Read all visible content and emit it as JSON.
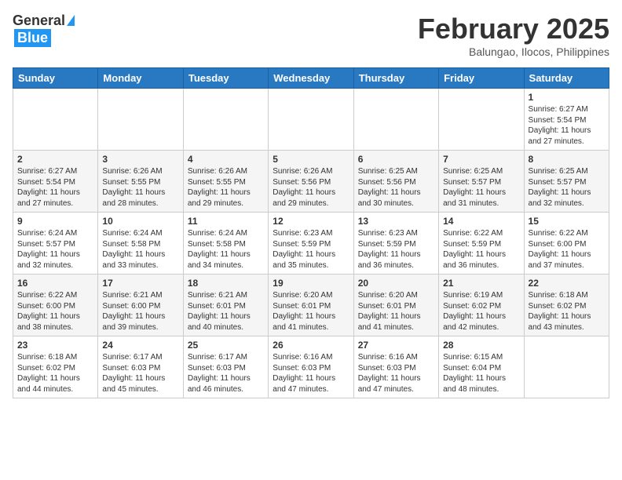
{
  "header": {
    "logo_general": "General",
    "logo_blue": "Blue",
    "month_year": "February 2025",
    "location": "Balungao, Ilocos, Philippines"
  },
  "days_of_week": [
    "Sunday",
    "Monday",
    "Tuesday",
    "Wednesday",
    "Thursday",
    "Friday",
    "Saturday"
  ],
  "weeks": [
    [
      {
        "day": "",
        "info": ""
      },
      {
        "day": "",
        "info": ""
      },
      {
        "day": "",
        "info": ""
      },
      {
        "day": "",
        "info": ""
      },
      {
        "day": "",
        "info": ""
      },
      {
        "day": "",
        "info": ""
      },
      {
        "day": "1",
        "info": "Sunrise: 6:27 AM\nSunset: 5:54 PM\nDaylight: 11 hours and 27 minutes."
      }
    ],
    [
      {
        "day": "2",
        "info": "Sunrise: 6:27 AM\nSunset: 5:54 PM\nDaylight: 11 hours and 27 minutes."
      },
      {
        "day": "3",
        "info": "Sunrise: 6:26 AM\nSunset: 5:55 PM\nDaylight: 11 hours and 28 minutes."
      },
      {
        "day": "4",
        "info": "Sunrise: 6:26 AM\nSunset: 5:55 PM\nDaylight: 11 hours and 29 minutes."
      },
      {
        "day": "5",
        "info": "Sunrise: 6:26 AM\nSunset: 5:56 PM\nDaylight: 11 hours and 29 minutes."
      },
      {
        "day": "6",
        "info": "Sunrise: 6:25 AM\nSunset: 5:56 PM\nDaylight: 11 hours and 30 minutes."
      },
      {
        "day": "7",
        "info": "Sunrise: 6:25 AM\nSunset: 5:57 PM\nDaylight: 11 hours and 31 minutes."
      },
      {
        "day": "8",
        "info": "Sunrise: 6:25 AM\nSunset: 5:57 PM\nDaylight: 11 hours and 32 minutes."
      }
    ],
    [
      {
        "day": "9",
        "info": "Sunrise: 6:24 AM\nSunset: 5:57 PM\nDaylight: 11 hours and 32 minutes."
      },
      {
        "day": "10",
        "info": "Sunrise: 6:24 AM\nSunset: 5:58 PM\nDaylight: 11 hours and 33 minutes."
      },
      {
        "day": "11",
        "info": "Sunrise: 6:24 AM\nSunset: 5:58 PM\nDaylight: 11 hours and 34 minutes."
      },
      {
        "day": "12",
        "info": "Sunrise: 6:23 AM\nSunset: 5:59 PM\nDaylight: 11 hours and 35 minutes."
      },
      {
        "day": "13",
        "info": "Sunrise: 6:23 AM\nSunset: 5:59 PM\nDaylight: 11 hours and 36 minutes."
      },
      {
        "day": "14",
        "info": "Sunrise: 6:22 AM\nSunset: 5:59 PM\nDaylight: 11 hours and 36 minutes."
      },
      {
        "day": "15",
        "info": "Sunrise: 6:22 AM\nSunset: 6:00 PM\nDaylight: 11 hours and 37 minutes."
      }
    ],
    [
      {
        "day": "16",
        "info": "Sunrise: 6:22 AM\nSunset: 6:00 PM\nDaylight: 11 hours and 38 minutes."
      },
      {
        "day": "17",
        "info": "Sunrise: 6:21 AM\nSunset: 6:00 PM\nDaylight: 11 hours and 39 minutes."
      },
      {
        "day": "18",
        "info": "Sunrise: 6:21 AM\nSunset: 6:01 PM\nDaylight: 11 hours and 40 minutes."
      },
      {
        "day": "19",
        "info": "Sunrise: 6:20 AM\nSunset: 6:01 PM\nDaylight: 11 hours and 41 minutes."
      },
      {
        "day": "20",
        "info": "Sunrise: 6:20 AM\nSunset: 6:01 PM\nDaylight: 11 hours and 41 minutes."
      },
      {
        "day": "21",
        "info": "Sunrise: 6:19 AM\nSunset: 6:02 PM\nDaylight: 11 hours and 42 minutes."
      },
      {
        "day": "22",
        "info": "Sunrise: 6:18 AM\nSunset: 6:02 PM\nDaylight: 11 hours and 43 minutes."
      }
    ],
    [
      {
        "day": "23",
        "info": "Sunrise: 6:18 AM\nSunset: 6:02 PM\nDaylight: 11 hours and 44 minutes."
      },
      {
        "day": "24",
        "info": "Sunrise: 6:17 AM\nSunset: 6:03 PM\nDaylight: 11 hours and 45 minutes."
      },
      {
        "day": "25",
        "info": "Sunrise: 6:17 AM\nSunset: 6:03 PM\nDaylight: 11 hours and 46 minutes."
      },
      {
        "day": "26",
        "info": "Sunrise: 6:16 AM\nSunset: 6:03 PM\nDaylight: 11 hours and 47 minutes."
      },
      {
        "day": "27",
        "info": "Sunrise: 6:16 AM\nSunset: 6:03 PM\nDaylight: 11 hours and 47 minutes."
      },
      {
        "day": "28",
        "info": "Sunrise: 6:15 AM\nSunset: 6:04 PM\nDaylight: 11 hours and 48 minutes."
      },
      {
        "day": "",
        "info": ""
      }
    ]
  ]
}
